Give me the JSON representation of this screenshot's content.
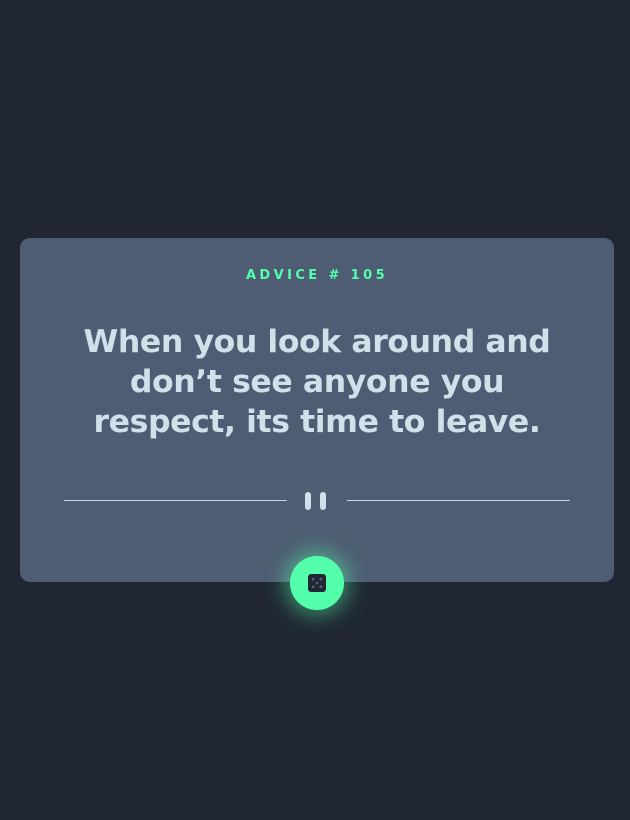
{
  "advice": {
    "label": "ADVICE # 105",
    "quote": "When you look around and don’t see anyone you respect, its time to leave."
  },
  "icons": {
    "divider": "pause-icon",
    "button": "dice-icon"
  },
  "colors": {
    "background": "#202733",
    "card": "#4e5d73",
    "accent": "#53ffaa",
    "text": "#cee3e9"
  }
}
